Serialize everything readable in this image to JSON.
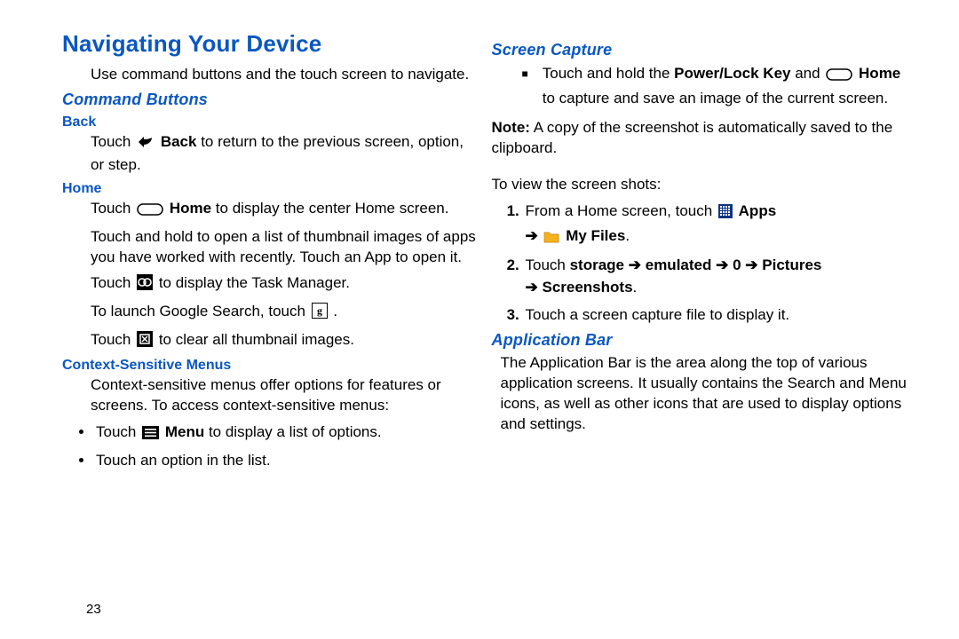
{
  "pageNumber": "23",
  "left": {
    "title": "Navigating Your Device",
    "intro": "Use command buttons and the touch screen to navigate.",
    "h2_command": "Command Buttons",
    "h3_back": "Back",
    "back_p_a": "Touch ",
    "back_b": "Back",
    "back_p_b": " to return to the previous screen, option, or step.",
    "h3_home": "Home",
    "home_p1_a": "Touch ",
    "home_p1_b": "Home",
    "home_p1_c": " to display the center Home screen.",
    "home_p2": "Touch and hold to open a list of thumbnail images of apps you have worked with recently. Touch an App to open it.",
    "home_p3_a": "Touch ",
    "home_p3_b": " to display the Task Manager.",
    "home_p4_a": "To launch Google Search, touch ",
    "home_p4_b": " .",
    "home_p5_a": "Touch ",
    "home_p5_b": " to clear all thumbnail images.",
    "h3_ctx": "Context-Sensitive Menus",
    "ctx_p": "Context-sensitive menus offer options for features or screens. To access context-sensitive menus:",
    "ctx_li1_a": "Touch ",
    "ctx_li1_b": "Menu",
    "ctx_li1_c": " to display a list of options.",
    "ctx_li2": "Touch an option in the list."
  },
  "right": {
    "h2_sc": "Screen Capture",
    "sc_li_a": "Touch and hold the ",
    "sc_li_b": "Power/Lock Key",
    "sc_li_c": " and ",
    "sc_li_d": "Home",
    "sc_li_e": " to capture and save an image of the current screen.",
    "note_a": "Note:",
    "note_b": " A copy of the screenshot is automatically saved to the clipboard.",
    "view_intro": "To view the screen shots:",
    "step1_a": "From a Home screen, touch ",
    "step1_b": "Apps",
    "step1_c": "My Files",
    "step1_d": ".",
    "step2_a": "Touch ",
    "step2_b": "storage",
    "step2_c": "emulated",
    "step2_d": "0",
    "step2_e": "Pictures",
    "step2_f": "Screenshots",
    "step2_g": ".",
    "step3": "Touch a screen capture file to display it.",
    "h2_app": "Application Bar",
    "app_p": "The Application Bar is the area along the top of various application screens. It usually contains the Search and Menu icons, as well as other icons that are used to display options and settings.",
    "arrow": "➔"
  }
}
